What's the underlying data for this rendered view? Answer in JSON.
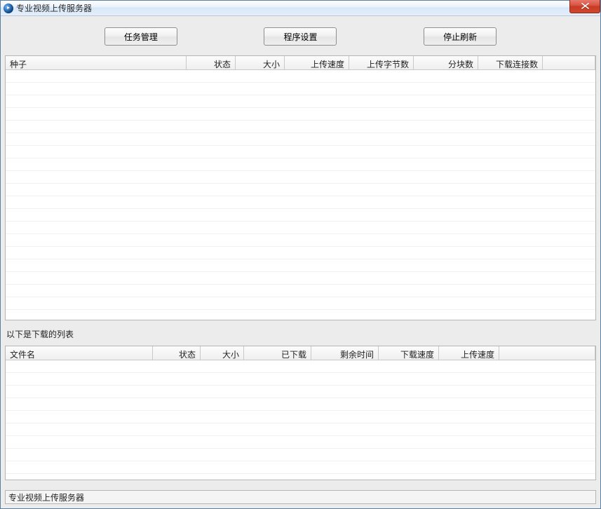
{
  "window": {
    "title": "专业视频上传服务器"
  },
  "toolbar": {
    "task_manager": "任务管理",
    "settings": "程序设置",
    "stop_refresh": "停止刷新"
  },
  "upload_table": {
    "columns": {
      "seed": "种子",
      "status": "状态",
      "size": "大小",
      "upload_speed": "上传速度",
      "upload_bytes": "上传字节数",
      "chunks": "分块数",
      "download_connections": "下载连接数"
    },
    "rows": []
  },
  "download_section": {
    "label": "以下是下载的列表"
  },
  "download_table": {
    "columns": {
      "filename": "文件名",
      "status": "状态",
      "size": "大小",
      "downloaded": "已下载",
      "remaining_time": "剩余时间",
      "download_speed": "下载速度",
      "upload_speed": "上传速度"
    },
    "rows": []
  },
  "statusbar": {
    "text": "专业视频上传服务器"
  }
}
